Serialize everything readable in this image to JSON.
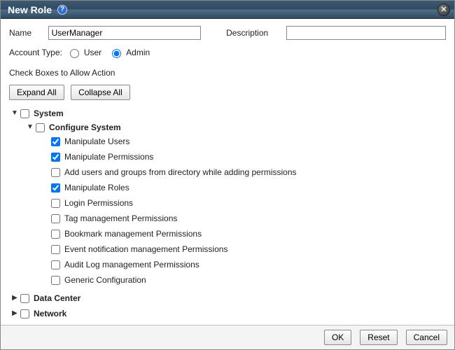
{
  "dialog": {
    "title": "New Role",
    "close_alt": "Close"
  },
  "fields": {
    "name_label": "Name",
    "name_value": "UserManager",
    "desc_label": "Description",
    "desc_value": ""
  },
  "account": {
    "label": "Account Type:",
    "option_user": "User",
    "option_admin": "Admin",
    "selected": "admin"
  },
  "permissions": {
    "heading": "Check Boxes to Allow Action",
    "expand_label": "Expand All",
    "collapse_label": "Collapse All"
  },
  "tree": {
    "system": {
      "label": "System",
      "checked": false,
      "expanded": true,
      "configure": {
        "label": "Configure System",
        "checked": false,
        "expanded": true,
        "items": [
          {
            "id": "manip-users",
            "label": "Manipulate Users",
            "checked": true
          },
          {
            "id": "manip-perms",
            "label": "Manipulate Permissions",
            "checked": true
          },
          {
            "id": "add-dir",
            "label": "Add users and groups from directory while adding permissions",
            "checked": false
          },
          {
            "id": "manip-roles",
            "label": "Manipulate Roles",
            "checked": true
          },
          {
            "id": "login-perms",
            "label": "Login Permissions",
            "checked": false
          },
          {
            "id": "tag-perms",
            "label": "Tag management Permissions",
            "checked": false
          },
          {
            "id": "bookmark-perms",
            "label": "Bookmark management Permissions",
            "checked": false
          },
          {
            "id": "event-perms",
            "label": "Event notification management Permissions",
            "checked": false
          },
          {
            "id": "audit-perms",
            "label": "Audit Log management Permissions",
            "checked": false
          },
          {
            "id": "generic-conf",
            "label": "Generic Configuration",
            "checked": false
          }
        ]
      }
    },
    "datacenter": {
      "label": "Data Center",
      "checked": false,
      "expanded": false
    },
    "network": {
      "label": "Network",
      "checked": false,
      "expanded": false
    }
  },
  "footer": {
    "ok": "OK",
    "reset": "Reset",
    "cancel": "Cancel"
  }
}
